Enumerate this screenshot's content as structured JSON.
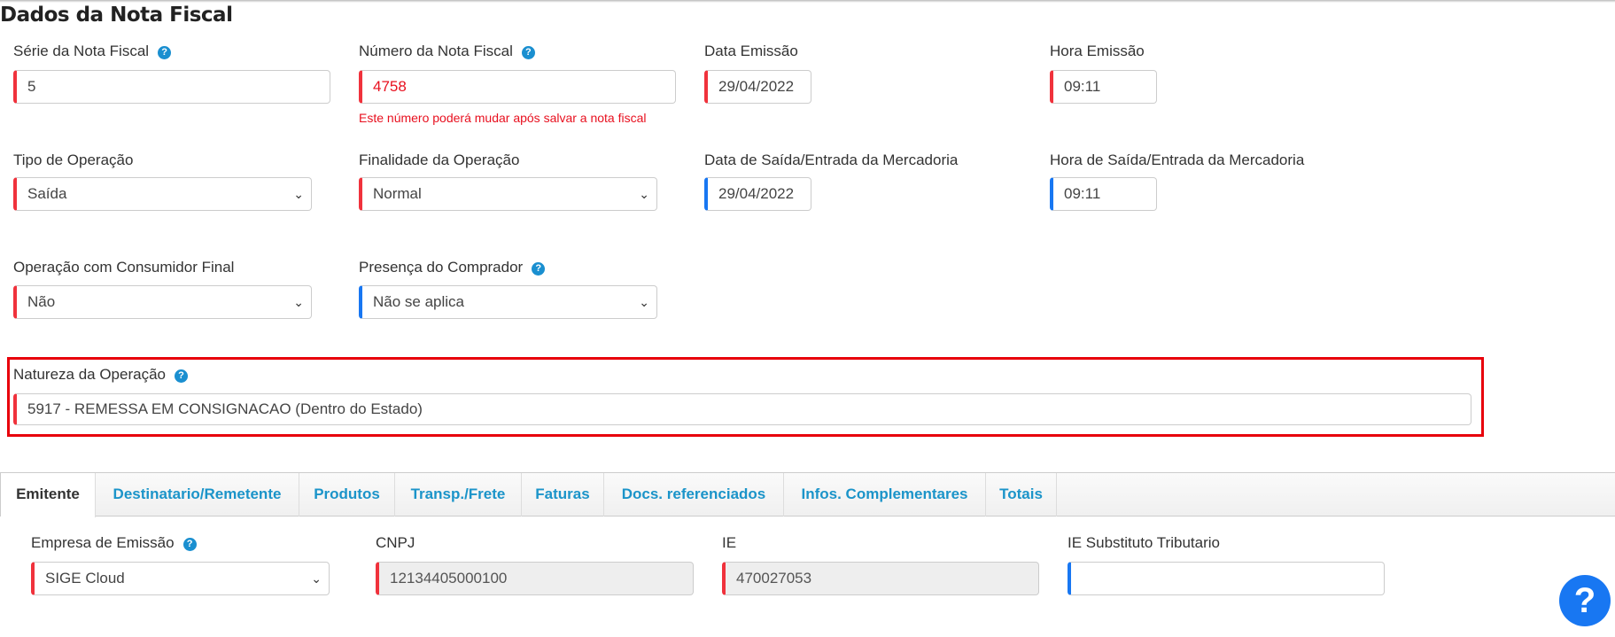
{
  "title": "Dados da Nota Fiscal",
  "fields": {
    "serie": {
      "label": "Série da Nota Fiscal",
      "value": "5"
    },
    "numero": {
      "label": "Número da Nota Fiscal",
      "value": "4758",
      "hint": "Este número poderá mudar após salvar a nota fiscal"
    },
    "data_emissao": {
      "label": "Data Emissão",
      "value": "29/04/2022"
    },
    "hora_emissao": {
      "label": "Hora Emissão",
      "value": "09:11"
    },
    "tipo_operacao": {
      "label": "Tipo de Operação",
      "value": "Saída"
    },
    "finalidade": {
      "label": "Finalidade da Operação",
      "value": "Normal"
    },
    "data_saida": {
      "label": "Data de Saída/Entrada da Mercadoria",
      "value": "29/04/2022"
    },
    "hora_saida": {
      "label": "Hora de Saída/Entrada da Mercadoria",
      "value": "09:11"
    },
    "consumidor_final": {
      "label": "Operação com Consumidor Final",
      "value": "Não"
    },
    "presenca": {
      "label": "Presença do Comprador",
      "value": "Não se aplica"
    },
    "natureza": {
      "label": "Natureza da Operação",
      "value": "5917 - REMESSA EM CONSIGNACAO (Dentro do Estado)"
    }
  },
  "tabs": [
    {
      "label": "Emitente",
      "active": true
    },
    {
      "label": "Destinatario/Remetente"
    },
    {
      "label": "Produtos"
    },
    {
      "label": "Transp./Frete"
    },
    {
      "label": "Faturas"
    },
    {
      "label": "Docs. referenciados"
    },
    {
      "label": "Infos. Complementares"
    },
    {
      "label": "Totais"
    }
  ],
  "emitente": {
    "empresa": {
      "label": "Empresa de Emissão",
      "value": "SIGE Cloud"
    },
    "cnpj": {
      "label": "CNPJ",
      "value": "12134405000100"
    },
    "ie": {
      "label": "IE",
      "value": "470027053"
    },
    "ie_st": {
      "label": "IE Substituto Tributario",
      "value": ""
    }
  },
  "help_icon_glyph": "?",
  "colors": {
    "required": "#f0323c",
    "optional": "#1877f2",
    "link": "#1b94c9",
    "highlight": "#e8000b"
  }
}
